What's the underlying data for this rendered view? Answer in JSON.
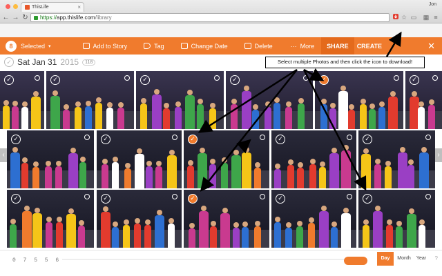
{
  "browser": {
    "tab_title": "ThisLife",
    "url_scheme": "https://",
    "url_host": "app.thislife.com",
    "url_path": "/library",
    "profile_name": "Jon"
  },
  "toolbar": {
    "selected_count": "8",
    "selected_label": "Selected",
    "add_to_story": "Add to Story",
    "tag": "Tag",
    "change_date": "Change Date",
    "delete": "Delete",
    "more": "More",
    "share": "SHARE",
    "create": "CREATE"
  },
  "date_header": {
    "date": "Sat Jan 31",
    "year": "2015",
    "count": "118"
  },
  "annotation": {
    "text": "Select multiple Photos and then click the icon to download!"
  },
  "bottom": {
    "digits": "0 7 5 5 6",
    "day": "Day",
    "month": "Month",
    "year": "Year",
    "help": "?"
  },
  "colors": {
    "brand_orange": "#f07b2d"
  },
  "rows": [
    [
      {
        "selected": false
      },
      {
        "selected": false
      },
      {
        "selected": false
      },
      {
        "selected": false
      },
      {
        "selected": true
      },
      {
        "selected": false
      }
    ],
    [
      {
        "selected": false
      },
      {
        "selected": false
      },
      {
        "selected": true
      },
      {
        "selected": false
      },
      {
        "selected": false
      },
      {
        "selected": false
      }
    ],
    [
      {
        "selected": false
      },
      {
        "selected": false
      },
      {
        "selected": true
      },
      {
        "selected": false
      },
      {
        "selected": false
      },
      {
        "selected": true
      }
    ]
  ]
}
